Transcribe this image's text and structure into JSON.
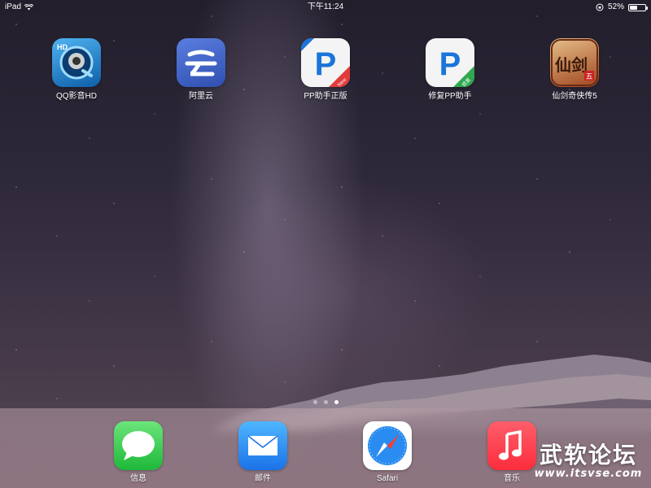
{
  "status_bar": {
    "device": "iPad",
    "time": "下午11:24",
    "battery": "52%",
    "battery_level": 0.52
  },
  "home_apps": [
    {
      "label": "QQ影音HD",
      "icon": "qq-player-hd-icon",
      "color": "#1e7fd0"
    },
    {
      "label": "阿里云",
      "icon": "aliyun-icon",
      "color": "#3f63c9"
    },
    {
      "label": "PP助手正版",
      "icon": "pp-assistant-icon",
      "color": "#1b74d8",
      "badge": "New"
    },
    {
      "label": "修复PP助手",
      "icon": "pp-repair-icon",
      "color": "#1b74d8",
      "badge": "修复"
    },
    {
      "label": "仙剑奇侠传5",
      "icon": "xianjian-5-icon",
      "color": "#b24a2a",
      "icon_text": "仙剑",
      "badge_char": "五"
    }
  ],
  "page_indicator": {
    "count": 3,
    "active": 3
  },
  "dock_apps": [
    {
      "label": "信息",
      "icon": "messages-icon",
      "color": "#34c759"
    },
    {
      "label": "邮件",
      "icon": "mail-icon",
      "color": "#1e8cf0"
    },
    {
      "label": "Safari",
      "icon": "safari-icon",
      "color": "#1e8cf0"
    },
    {
      "label": "音乐",
      "icon": "music-icon",
      "color": "#fc3c44"
    }
  ],
  "watermark": {
    "title": "武软论坛",
    "url": "www.itsvse.com"
  }
}
